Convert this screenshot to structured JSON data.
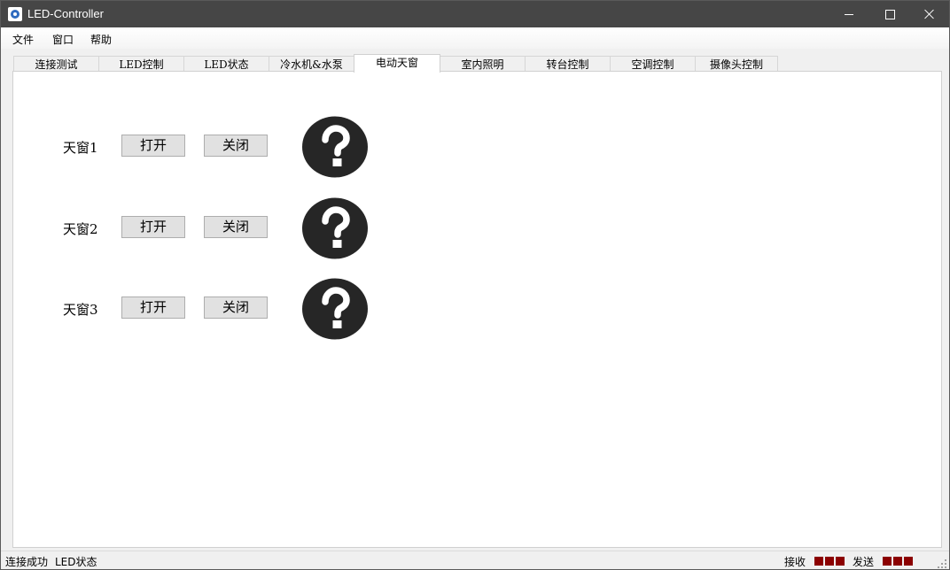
{
  "window": {
    "title": "LED-Controller"
  },
  "menu": [
    "文件",
    "窗口",
    "帮助"
  ],
  "tabs": [
    "连接测试",
    "LED控制",
    "LED状态",
    "冷水机&水泵",
    "电动天窗",
    "室内照明",
    "转台控制",
    "空调控制",
    "摄像头控制"
  ],
  "active_tab": "电动天窗",
  "skylights": [
    {
      "label": "天窗1",
      "open": "打开",
      "close": "关闭",
      "status_icon": "question-icon"
    },
    {
      "label": "天窗2",
      "open": "打开",
      "close": "关闭",
      "status_icon": "question-icon"
    },
    {
      "label": "天窗3",
      "open": "打开",
      "close": "关闭",
      "status_icon": "question-icon"
    }
  ],
  "status": {
    "connection": "连接成功",
    "page": "LED状态",
    "receive_label": "接收",
    "send_label": "发送",
    "indicator_color": "#8b0000"
  },
  "colors": {
    "titlebar": "#464646",
    "question_bg": "#262626"
  }
}
